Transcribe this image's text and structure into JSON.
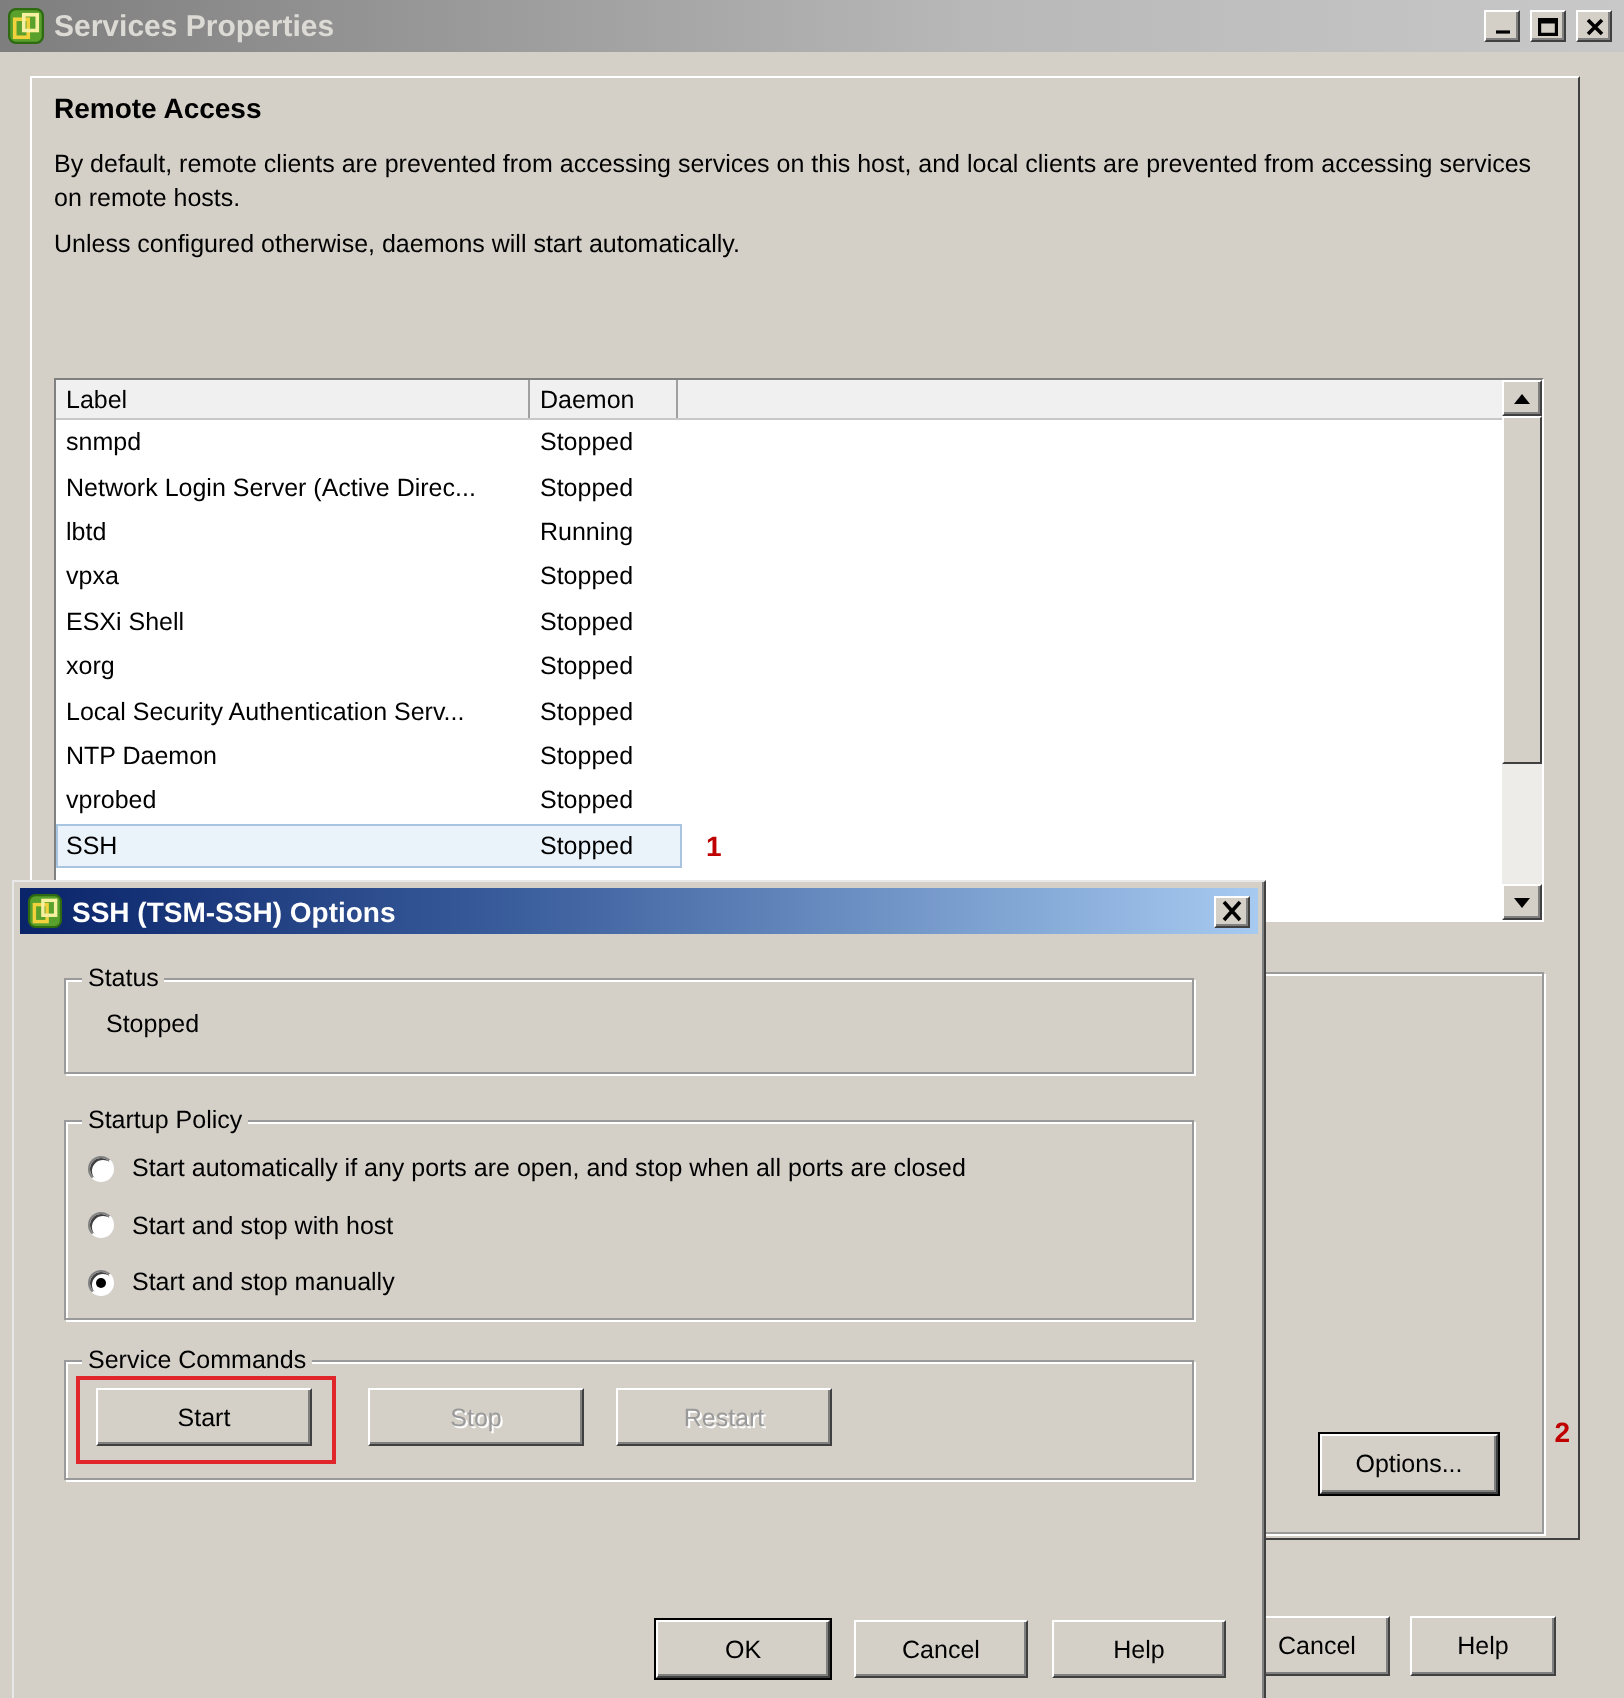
{
  "window": {
    "title": "Services Properties"
  },
  "remote_access": {
    "heading": "Remote Access",
    "paragraphs": [
      "By default, remote clients are prevented from accessing services on this host, and local clients are prevented from accessing services on remote hosts.",
      "Unless configured otherwise, daemons will start automatically."
    ]
  },
  "services_table": {
    "columns": [
      "Label",
      "Daemon"
    ],
    "rows": [
      {
        "label": "snmpd",
        "daemon": "Stopped",
        "selected": false
      },
      {
        "label": "Network Login Server (Active Direc...",
        "daemon": "Stopped",
        "selected": false
      },
      {
        "label": "lbtd",
        "daemon": "Running",
        "selected": false
      },
      {
        "label": "vpxa",
        "daemon": "Stopped",
        "selected": false
      },
      {
        "label": "ESXi Shell",
        "daemon": "Stopped",
        "selected": false
      },
      {
        "label": "xorg",
        "daemon": "Stopped",
        "selected": false
      },
      {
        "label": "Local Security Authentication Serv...",
        "daemon": "Stopped",
        "selected": false
      },
      {
        "label": "NTP Daemon",
        "daemon": "Stopped",
        "selected": false
      },
      {
        "label": "vprobed",
        "daemon": "Stopped",
        "selected": false
      },
      {
        "label": "SSH",
        "daemon": "Stopped",
        "selected": true,
        "annotation": "1"
      }
    ]
  },
  "options_button": {
    "label": "Options...",
    "annotation": "2"
  },
  "footer_buttons": [
    "Cancel",
    "Help"
  ],
  "dialog": {
    "title": "SSH (TSM-SSH) Options",
    "status": {
      "title": "Status",
      "value": "Stopped"
    },
    "startup_policy": {
      "title": "Startup Policy",
      "options": [
        {
          "label": "Start automatically if any ports are open, and stop when all ports are closed",
          "selected": false
        },
        {
          "label": "Start and stop with host",
          "selected": false
        },
        {
          "label": "Start and stop manually",
          "selected": true
        }
      ]
    },
    "service_commands": {
      "title": "Service Commands",
      "buttons": [
        {
          "label": "Start",
          "disabled": false,
          "highlighted": true
        },
        {
          "label": "Stop",
          "disabled": true,
          "highlighted": false
        },
        {
          "label": "Restart",
          "disabled": true,
          "highlighted": false
        }
      ]
    },
    "buttons": [
      {
        "label": "OK",
        "default": true
      },
      {
        "label": "Cancel",
        "default": false
      },
      {
        "label": "Help",
        "default": false
      }
    ]
  }
}
